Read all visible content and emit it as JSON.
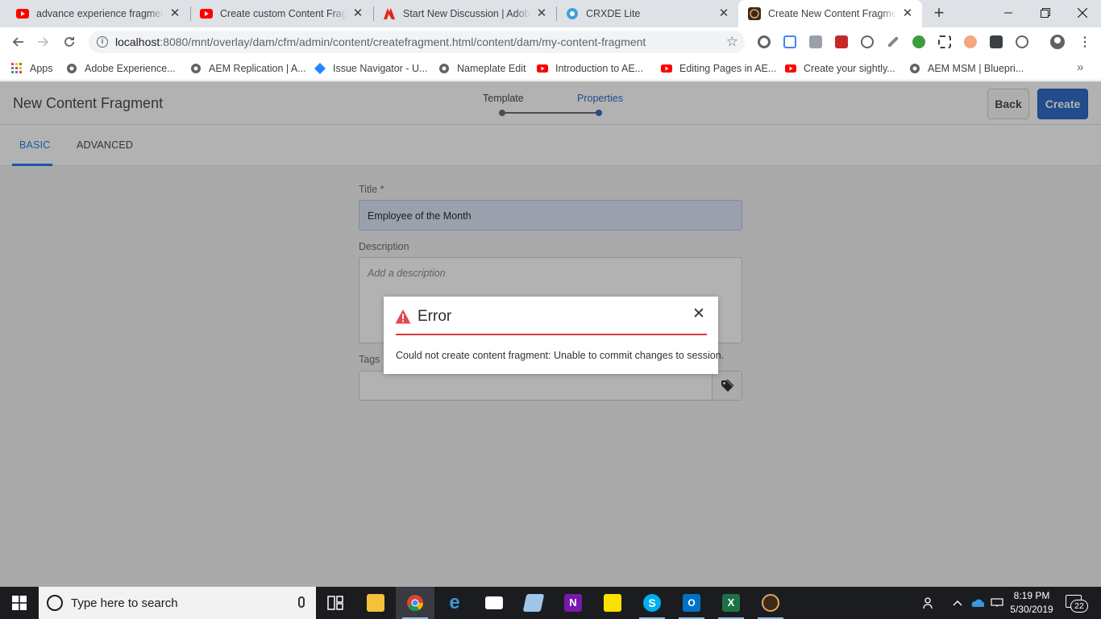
{
  "browser": {
    "tabs": [
      {
        "title": "advance experience fragments",
        "favicon": "youtube-icon",
        "active": false
      },
      {
        "title": "Create custom Content Fragme",
        "favicon": "youtube-icon",
        "active": false
      },
      {
        "title": "Start New Discussion | Adobe C",
        "favicon": "adobe-icon",
        "active": false
      },
      {
        "title": "CRXDE Lite",
        "favicon": "crxde-icon",
        "active": false
      },
      {
        "title": "Create New Content Fragment",
        "favicon": "aem-icon",
        "active": true
      }
    ],
    "url_host": "localhost",
    "url_rest": ":8080/mnt/overlay/dam/cfm/admin/content/createfragment.html/content/dam/my-content-fragment",
    "bookmarks": [
      {
        "label": "Apps",
        "icon": "apps-grid-icon"
      },
      {
        "label": "Adobe Experience...",
        "icon": "globe-icon"
      },
      {
        "label": "AEM Replication | A...",
        "icon": "globe-icon"
      },
      {
        "label": "Issue Navigator - U...",
        "icon": "jira-icon"
      },
      {
        "label": "Nameplate Edit",
        "icon": "globe-icon"
      },
      {
        "label": "Introduction to AE...",
        "icon": "youtube-icon"
      },
      {
        "label": "Editing Pages in AE...",
        "icon": "youtube-icon"
      },
      {
        "label": "Create your sightly...",
        "icon": "youtube-icon"
      },
      {
        "label": "AEM MSM | Bluepri...",
        "icon": "globe-icon"
      }
    ]
  },
  "aem": {
    "page_title": "New Content Fragment",
    "wizard_steps": [
      {
        "label": "Template",
        "state": "done"
      },
      {
        "label": "Properties",
        "state": "current"
      }
    ],
    "back_label": "Back",
    "create_label": "Create",
    "tabs": [
      {
        "label": "BASIC",
        "active": true
      },
      {
        "label": "ADVANCED",
        "active": false
      }
    ],
    "form": {
      "title_label": "Title *",
      "title_value": "Employee of the Month",
      "description_label": "Description",
      "description_placeholder": "Add a description",
      "tags_label": "Tags"
    }
  },
  "dialog": {
    "title": "Error",
    "message": "Could not create content fragment: Unable to commit changes to session."
  },
  "taskbar": {
    "search_placeholder": "Type here to search",
    "time": "8:19 PM",
    "date": "5/30/2019",
    "notifications": "22"
  },
  "colors": {
    "accent": "#326ec8",
    "error": "#d7373f",
    "tab_indicator": "#2680eb"
  }
}
